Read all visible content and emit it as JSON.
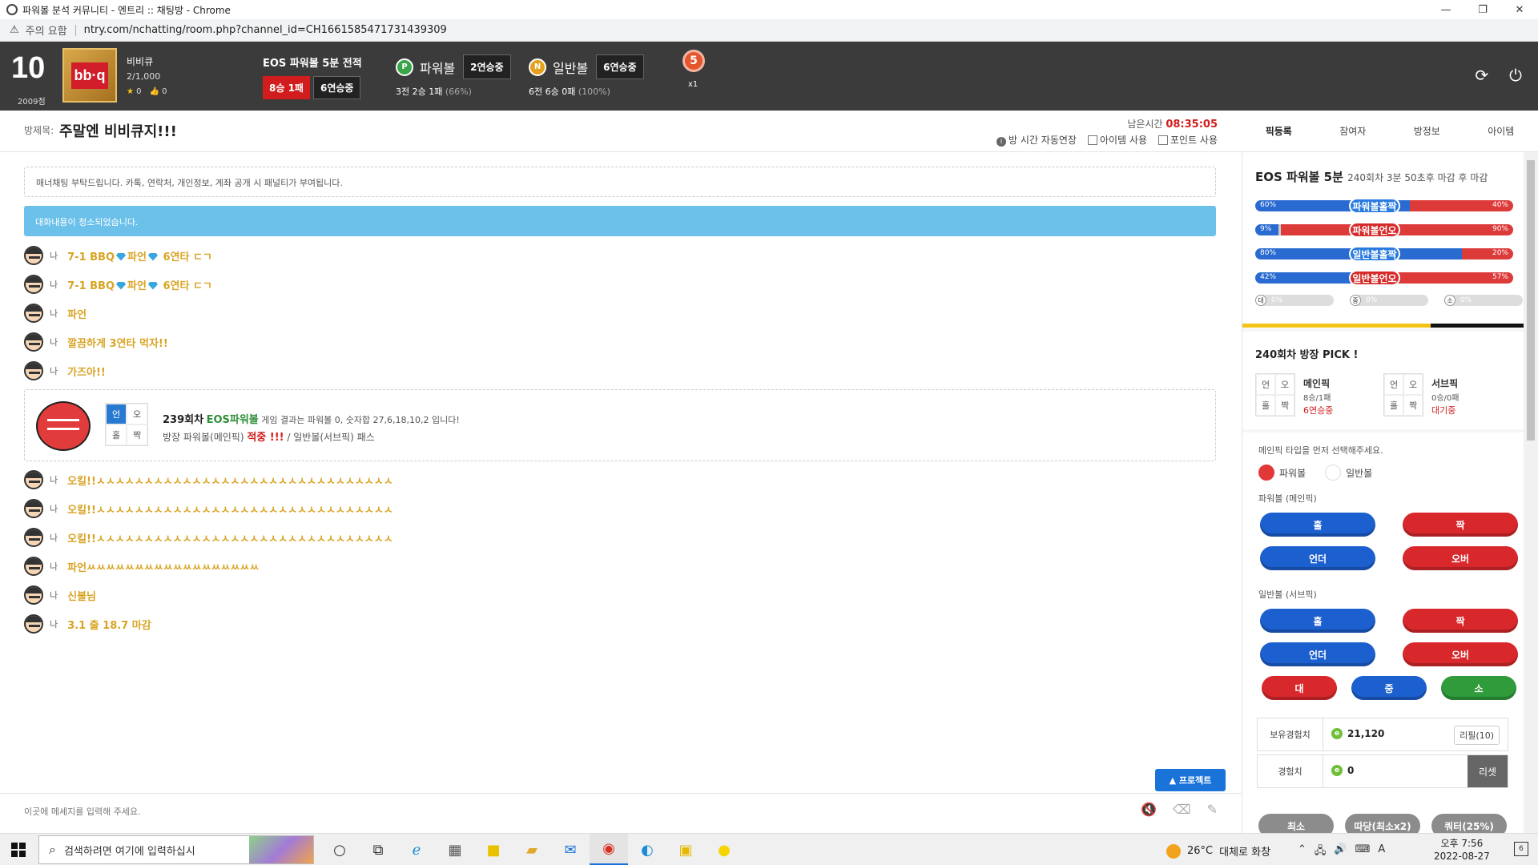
{
  "browser": {
    "title": "파워볼 분석 커뮤니티 - 엔트리 :: 채팅방 - Chrome",
    "security_label": "주의 요함",
    "url": "ntry.com/nchatting/room.php?channel_id=CH1661585471731439309"
  },
  "profile": {
    "level": "10",
    "points": "2009점",
    "logo_text": "bb·q",
    "name": "비비큐",
    "exp": "2/1,000",
    "stars": "0",
    "likes": "0"
  },
  "record": {
    "title": "EOS 파워볼 5분 전적",
    "record": "8승 1패",
    "streak": "6연승중"
  },
  "powerball": {
    "badge": "P",
    "label": "파워볼",
    "streak": "2연승중",
    "stats": "3전 2승 1패",
    "pct": "(66%)"
  },
  "normalball": {
    "badge": "N",
    "label": "일반볼",
    "streak": "6연승중",
    "stats": "6전 6승 0패",
    "pct": "(100%)"
  },
  "medal": {
    "number": "5",
    "multiplier": "x1"
  },
  "room": {
    "label": "방제목:",
    "title": "주말엔 비비큐지!!!",
    "remain_label": "남은시간",
    "remain_time": "08:35:05",
    "auto_extend": "방 시간 자동연장",
    "use_item": "아이템 사용",
    "use_point": "포인트 사용"
  },
  "tabs": [
    "픽등록",
    "참여자",
    "방정보",
    "아이템"
  ],
  "chat": {
    "notice": "매너채팅 부탁드립니다. 카톡, 연락처, 개인정보, 계좌 공개 시 패널티가 부여됩니다.",
    "cleared": "대화내용이 청소되었습니다.",
    "me": "나",
    "messages_top": [
      {
        "a": "7-1 BBQ",
        "b": "파언",
        "c": " 6연타 ㄷㄱ"
      },
      {
        "a": "7-1 BBQ",
        "b": "파언",
        "c": " 6연타 ㄷㄱ"
      }
    ],
    "plain_top": [
      "파언",
      "깔끔하게 3연타 먹자!!",
      "가즈아!!"
    ],
    "result": {
      "grid": [
        "언",
        "오",
        "홀",
        "짝"
      ],
      "round": "239회차",
      "game": "EOS파워볼",
      "text": "게임 결과는 파워볼 0, 숫자합 27,6,18,10,2 입니다!",
      "line2a": "방장 파워볼(메인픽)",
      "hit": "적중 !!!",
      "line2b": "/ 일반볼(서브픽)",
      "pass": "패스"
    },
    "plain_bottom": [
      "오킬!!ㅅㅅㅅㅅㅅㅅㅅㅅㅅㅅㅅㅅㅅㅅㅅㅅㅅㅅㅅㅅㅅㅅㅅㅅㅅㅅㅅㅅㅅㅅㅅ",
      "오킬!!ㅅㅅㅅㅅㅅㅅㅅㅅㅅㅅㅅㅅㅅㅅㅅㅅㅅㅅㅅㅅㅅㅅㅅㅅㅅㅅㅅㅅㅅㅅㅅ",
      "오킬!!ㅅㅅㅅㅅㅅㅅㅅㅅㅅㅅㅅㅅㅅㅅㅅㅅㅅㅅㅅㅅㅅㅅㅅㅅㅅㅅㅅㅅㅅㅅㅅ",
      "파언ㅆㅆㅆㅆㅆㅆㅆㅆㅆㅆㅆㅆㅆㅆㅆㅆㅆㅆ",
      "신불님",
      "3.1 출 18.7 마감"
    ],
    "input_placeholder": "이곳에 메세지를 입력해 주세요.",
    "protect": "▲ 프로젝트"
  },
  "panel": {
    "head": "EOS 파워볼 5분",
    "head_sub": "240회차 3분 50초후 마감 후 마감",
    "bars": [
      {
        "label": "파워볼홀짝",
        "left": "60%",
        "right": "40%",
        "color": "blue"
      },
      {
        "label": "파워볼언오",
        "left": "9%",
        "right": "90%",
        "color": "red"
      },
      {
        "label": "일반볼홀짝",
        "left": "80%",
        "right": "20%",
        "color": "blue"
      },
      {
        "label": "일반볼언오",
        "left": "42%",
        "right": "57%",
        "color": "red"
      }
    ],
    "mini": [
      {
        "icon": "대",
        "pct": "0%"
      },
      {
        "icon": "중",
        "pct": "0%"
      },
      {
        "icon": "소",
        "pct": "0%"
      }
    ],
    "pick_head": "240회차 방장 PICK !",
    "pick_grid": [
      "언",
      "오",
      "홀",
      "짝"
    ],
    "main_pick": {
      "title": "메인픽",
      "record": "8승/1패",
      "status": "6연승중"
    },
    "sub_pick": {
      "title": "서브픽",
      "record": "0승/0패",
      "status": "대기중"
    },
    "select_hint": "메인픽 타입을 먼저 선택해주세요.",
    "radio_power": "파워볼",
    "radio_normal": "일반볼",
    "sect_power": "파워볼 (메인픽)",
    "sect_normal": "일반볼 (서브픽)",
    "btn_odd": "홀",
    "btn_even": "짝",
    "btn_under": "언더",
    "btn_over": "오버",
    "btn_big": "대",
    "btn_mid": "중",
    "btn_small": "소",
    "exp_label": "보유경험치",
    "exp_value": "21,120",
    "refill": "리필(10)",
    "exp2_label": "경험치",
    "exp2_value": "0",
    "reset": "리셋",
    "g1": "최소",
    "g2": "따당(최소x2)",
    "g3": "쿼터(25%)"
  },
  "taskbar": {
    "search": "검색하려면 여기에 입력하십시",
    "temp": "26°C",
    "weather": "대체로 화창",
    "ime": "A",
    "time": "오후 7:56",
    "date": "2022-08-27",
    "notif": "6"
  },
  "colors": {
    "accent_blue": "#2a7be0",
    "accent_red": "#d62a2a",
    "header_bg": "#3b3b3b",
    "gold_text": "#d9a425"
  }
}
